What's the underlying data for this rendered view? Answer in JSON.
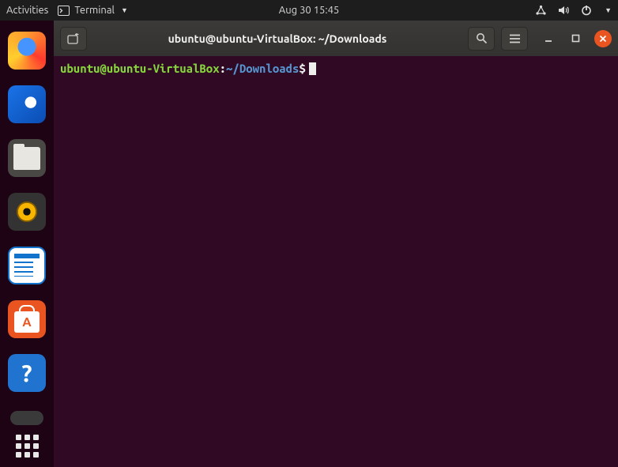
{
  "topbar": {
    "activities": "Activities",
    "app_name": "Terminal",
    "datetime": "Aug 30  15:45"
  },
  "window": {
    "title": "ubuntu@ubuntu-VirtualBox: ~/Downloads"
  },
  "terminal": {
    "user_host": "ubuntu@ubuntu-VirtualBox",
    "separator": ":",
    "path": "~/Downloads",
    "prompt_char": "$"
  },
  "dock": {
    "items": [
      {
        "name": "firefox",
        "active": false
      },
      {
        "name": "thunderbird",
        "active": false
      },
      {
        "name": "files",
        "active": false
      },
      {
        "name": "rhythmbox",
        "active": false
      },
      {
        "name": "writer",
        "active": false
      },
      {
        "name": "software",
        "active": false
      },
      {
        "name": "help",
        "active": false
      }
    ],
    "help_glyph": "?"
  }
}
